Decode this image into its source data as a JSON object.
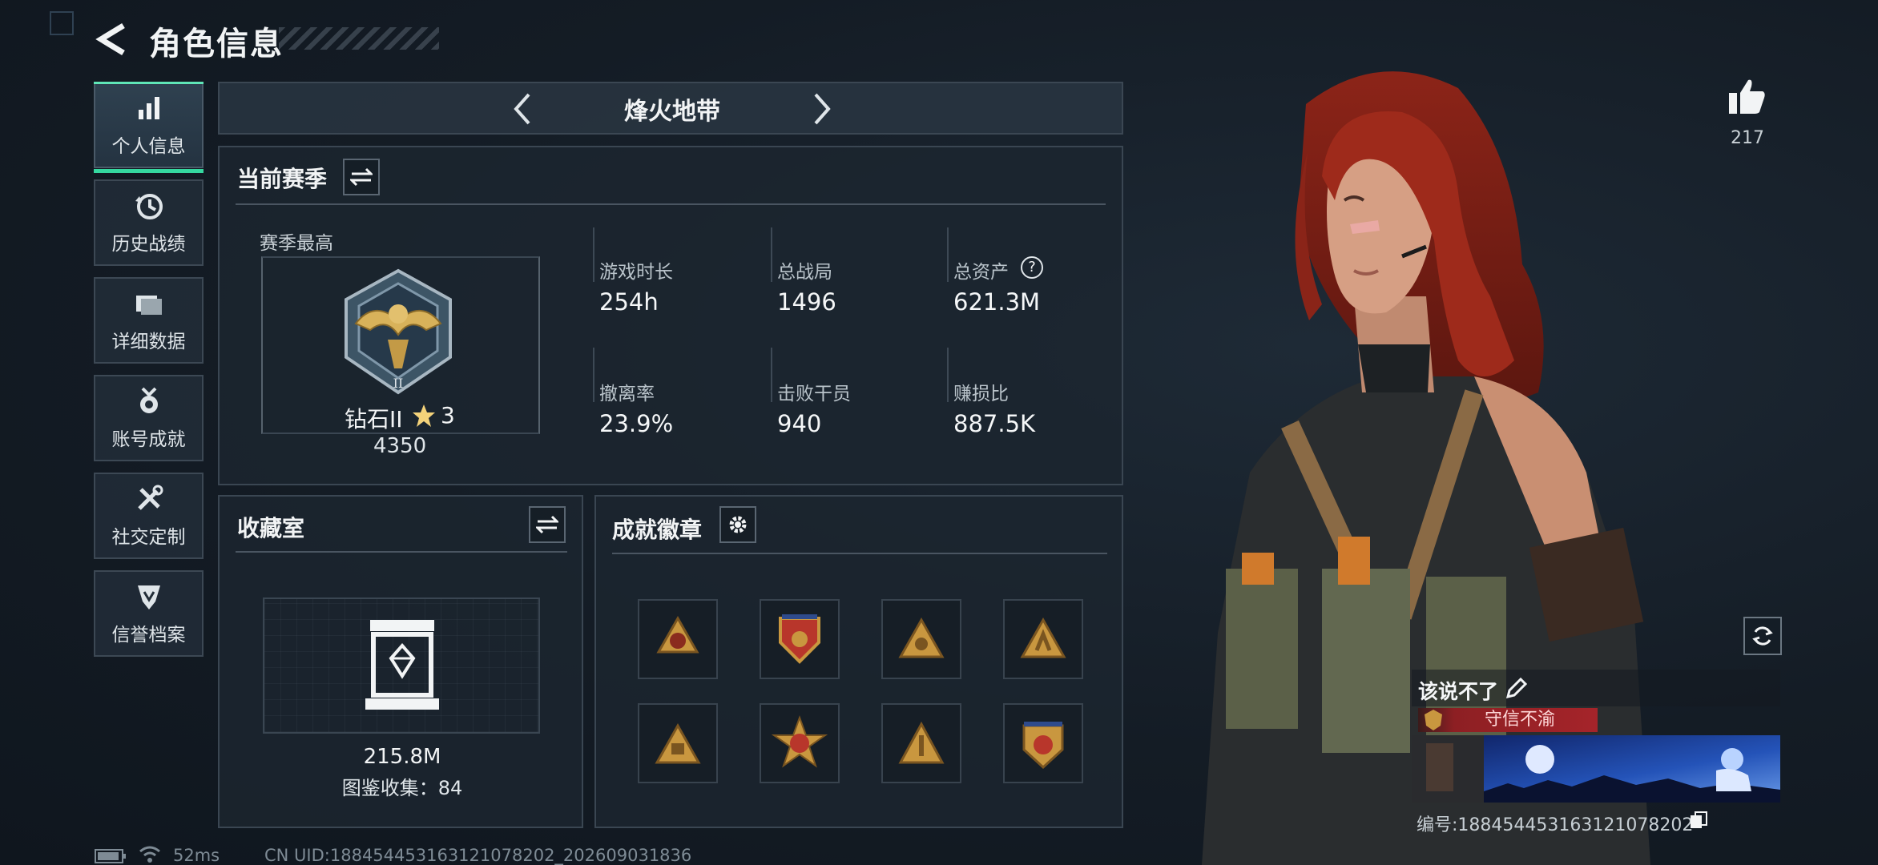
{
  "header": {
    "title": "角色信息"
  },
  "sidebar": {
    "items": [
      {
        "label": "个人信息",
        "icon": "bar-chart-icon",
        "active": true
      },
      {
        "label": "历史战绩",
        "icon": "clock-history-icon",
        "active": false
      },
      {
        "label": "详细数据",
        "icon": "folder-icon",
        "active": false
      },
      {
        "label": "账号成就",
        "icon": "medal-icon",
        "active": false
      },
      {
        "label": "社交定制",
        "icon": "wrench-screwdriver-icon",
        "active": false
      },
      {
        "label": "信誉档案",
        "icon": "shield-check-icon",
        "active": false
      }
    ]
  },
  "mode": {
    "title": "烽火地带"
  },
  "season": {
    "title": "当前赛季",
    "best_label": "赛季最高",
    "rank_name": "钻石II",
    "rank_stars": "3",
    "rank_points": "4350",
    "stats": [
      {
        "label": "游戏时长",
        "value": "254h"
      },
      {
        "label": "总战局",
        "value": "1496"
      },
      {
        "label": "总资产",
        "value": "621.3M",
        "help": "?"
      },
      {
        "label": "撤离率",
        "value": "23.9%"
      },
      {
        "label": "击败干员",
        "value": "940"
      },
      {
        "label": "赚损比",
        "value": "887.5K"
      }
    ]
  },
  "collection": {
    "title": "收藏室",
    "value": "215.8M",
    "count_text": "图鉴收集：84"
  },
  "achievements": {
    "title": "成就徽章",
    "badges": [
      "badge-1",
      "badge-2",
      "badge-3",
      "badge-4",
      "badge-5",
      "badge-6",
      "badge-7",
      "badge-8"
    ]
  },
  "profile": {
    "likes": "217",
    "nickname": "该说不了",
    "title_tag": "守信不渝",
    "id_text": "编号:18845445316312107820​2"
  },
  "status_bar": {
    "ping": "52ms",
    "uid": "CN UID:18845445316312107820​2_202609031836"
  },
  "colors": {
    "accent": "#35d8a0",
    "badge_gold": "#c9973f",
    "title_red": "#a5242a"
  }
}
